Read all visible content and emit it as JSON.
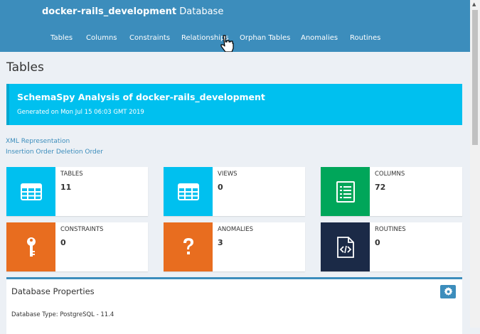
{
  "header": {
    "db_name": "docker-rails_development",
    "db_suffix": "Database",
    "nav": [
      "Tables",
      "Columns",
      "Constraints",
      "Relationships",
      "Orphan Tables",
      "Anomalies",
      "Routines"
    ]
  },
  "page": {
    "title": "Tables",
    "callout_title": "SchemaSpy Analysis of docker-rails_development",
    "callout_subtitle": "Generated on Mon Jul 15 06:03 GMT 2019",
    "links": [
      "XML Representation",
      "Insertion Order Deletion Order"
    ]
  },
  "stats": [
    {
      "label": "TABLES",
      "value": "11",
      "color": "#00c0ef",
      "icon": "table-icon"
    },
    {
      "label": "VIEWS",
      "value": "0",
      "color": "#00c0ef",
      "icon": "table-icon"
    },
    {
      "label": "COLUMNS",
      "value": "72",
      "color": "#00a65a",
      "icon": "list-icon"
    },
    {
      "label": "CONSTRAINTS",
      "value": "0",
      "color": "#e86d1f",
      "icon": "key-icon"
    },
    {
      "label": "ANOMALIES",
      "value": "3",
      "color": "#e86d1f",
      "icon": "question-icon"
    },
    {
      "label": "ROUTINES",
      "value": "0",
      "color": "#1b2a47",
      "icon": "code-file-icon"
    }
  ],
  "properties": {
    "heading": "Database Properties",
    "db_type": "Database Type: PostgreSQL - 11.4"
  }
}
